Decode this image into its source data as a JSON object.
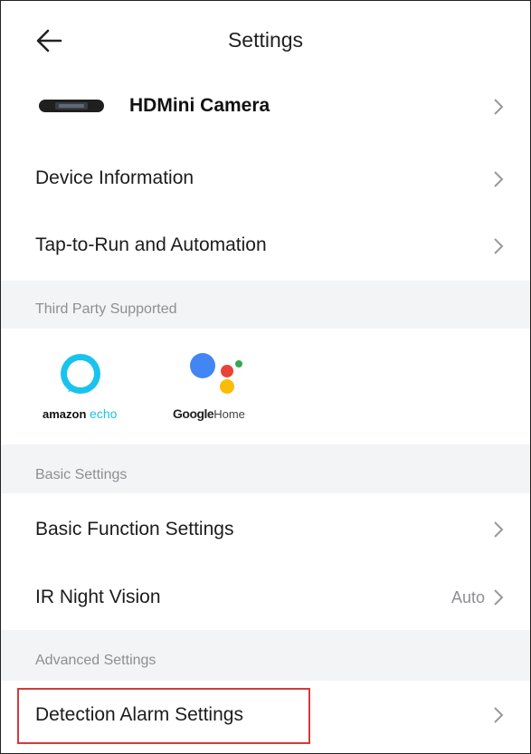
{
  "header": {
    "title": "Settings",
    "back_icon": "arrow-left-icon"
  },
  "device": {
    "name": "HDMini Camera",
    "icon": "camera-device-icon"
  },
  "rows_top": [
    {
      "label": "Device Information"
    },
    {
      "label": "Tap-to-Run and Automation"
    }
  ],
  "third_party": {
    "title": "Third Party Supported",
    "partners": [
      {
        "brand": "amazon",
        "product": "echo",
        "icon": "amazon-echo-icon"
      },
      {
        "brand": "Google",
        "product": "Home",
        "icon": "google-home-icon"
      }
    ]
  },
  "basic_settings": {
    "title": "Basic Settings",
    "items": [
      {
        "label": "Basic Function Settings",
        "value": ""
      },
      {
        "label": "IR Night Vision",
        "value": "Auto"
      }
    ]
  },
  "advanced_settings": {
    "title": "Advanced Settings",
    "items": [
      {
        "label": "Detection Alarm Settings",
        "highlighted": true
      }
    ]
  },
  "colors": {
    "highlight_border": "#d53a3a",
    "section_bg": "#f3f4f6",
    "alexa_cyan": "#19c3ee",
    "google_blue": "#4285f4",
    "google_red": "#ea4335",
    "google_yellow": "#fbbc05",
    "google_green": "#34a853"
  }
}
